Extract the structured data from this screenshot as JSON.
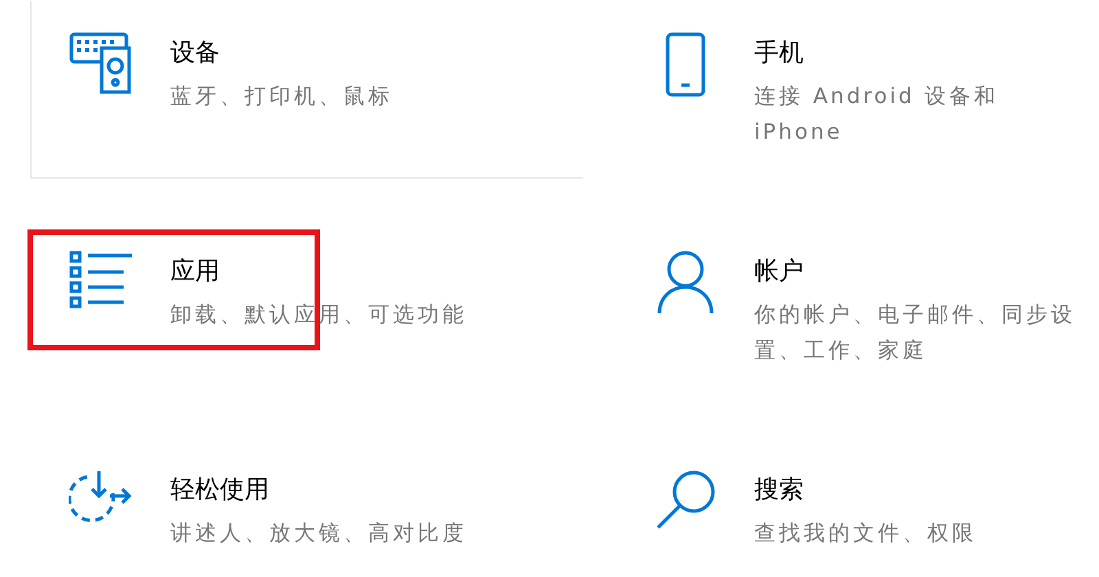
{
  "tiles": [
    {
      "title": "设备",
      "subtitle": "蓝牙、打印机、鼠标",
      "hovered": true,
      "highlighted": false
    },
    {
      "title": "手机",
      "subtitle": "连接 Android 设备和 iPhone",
      "hovered": false,
      "highlighted": false
    },
    {
      "title": "应用",
      "subtitle": "卸载、默认应用、可选功能",
      "hovered": false,
      "highlighted": true
    },
    {
      "title": "帐户",
      "subtitle": "你的帐户、电子邮件、同步设置、工作、家庭",
      "hovered": false,
      "highlighted": false
    },
    {
      "title": "轻松使用",
      "subtitle": "讲述人、放大镜、高对比度",
      "hovered": false,
      "highlighted": false
    },
    {
      "title": "搜索",
      "subtitle": "查找我的文件、权限",
      "hovered": false,
      "highlighted": false
    }
  ]
}
